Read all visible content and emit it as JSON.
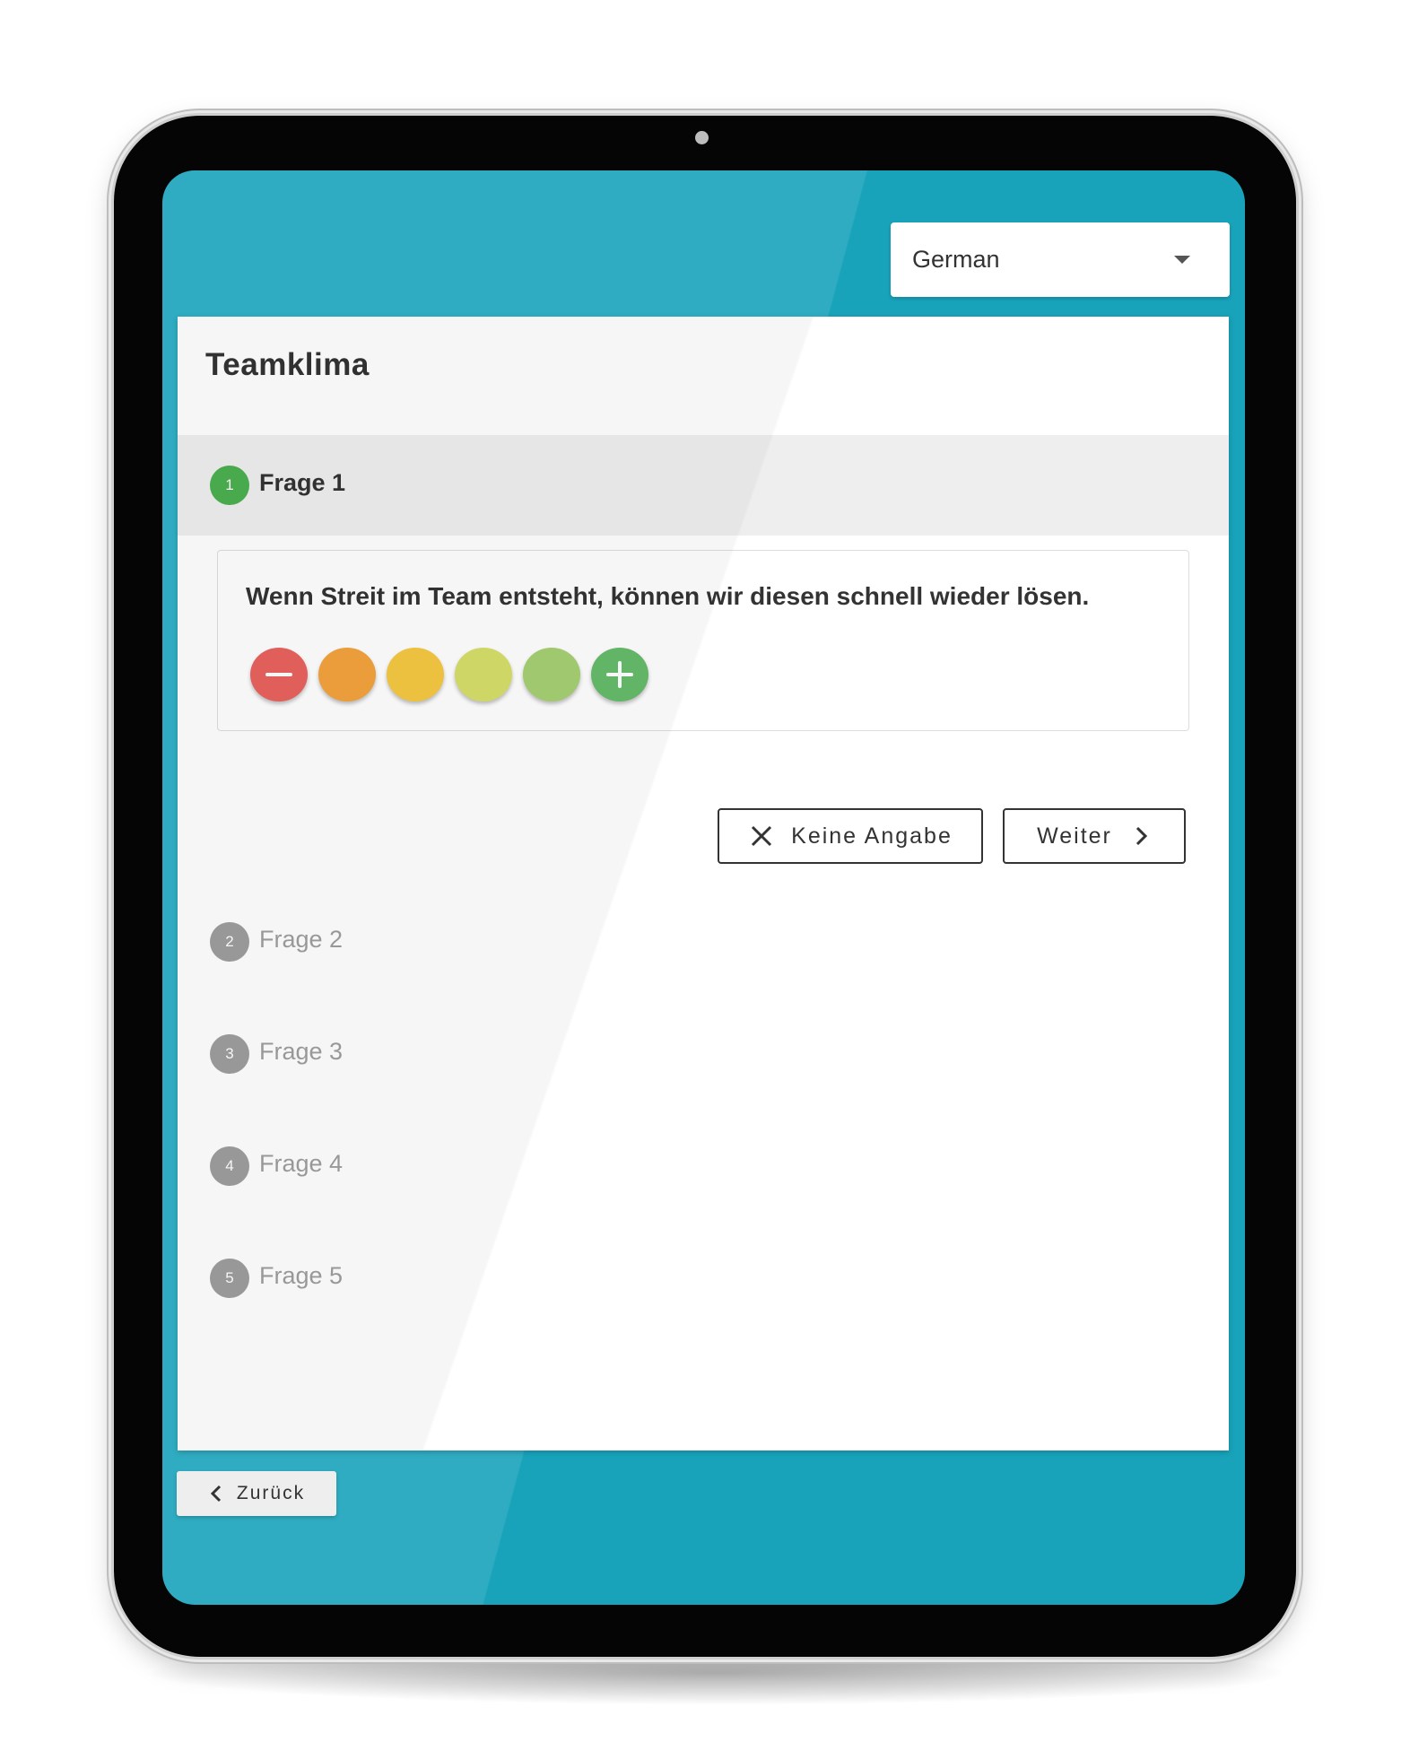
{
  "language_select": {
    "value": "German"
  },
  "survey": {
    "title": "Teamklima",
    "steps": [
      {
        "number": "1",
        "label": "Frage 1",
        "state": "active"
      },
      {
        "number": "2",
        "label": "Frage 2",
        "state": "inactive"
      },
      {
        "number": "3",
        "label": "Frage 3",
        "state": "inactive"
      },
      {
        "number": "4",
        "label": "Frage 4",
        "state": "inactive"
      },
      {
        "number": "5",
        "label": "Frage 5",
        "state": "inactive"
      }
    ],
    "question": {
      "text": "Wenn Streit im Team entsteht, können wir diesen schnell wieder lösen.",
      "rating_options": [
        {
          "color": "#e8625e",
          "icon": "minus-icon"
        },
        {
          "color": "#f2a33c"
        },
        {
          "color": "#f5c842"
        },
        {
          "color": "#d6df6a"
        },
        {
          "color": "#a6cf72"
        },
        {
          "color": "#66bb6a",
          "icon": "plus-icon"
        }
      ]
    },
    "actions": {
      "skip_label": "Keine Angabe",
      "next_label": "Weiter"
    }
  },
  "footer": {
    "back_label": "Zurück"
  },
  "colors": {
    "background_teal": "#18a3bb",
    "active_step": "#4caf50",
    "inactive_step": "#9e9e9e"
  }
}
